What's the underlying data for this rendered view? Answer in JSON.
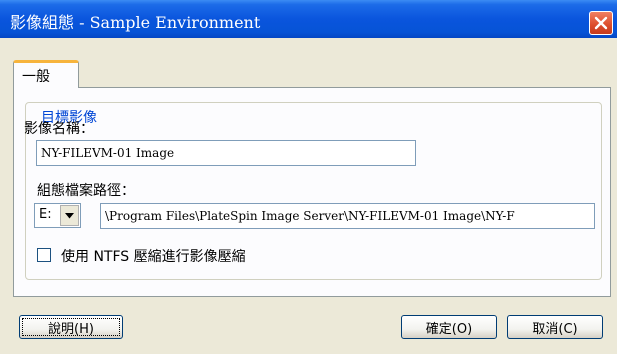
{
  "window": {
    "title": "影像組態 - Sample Environment",
    "close_icon": "close-icon"
  },
  "tabs": [
    {
      "label": "一般",
      "selected": true
    }
  ],
  "group": {
    "legend": "目標影像"
  },
  "image_name": {
    "label": "影像名稱：",
    "value": "NY-FILEVM-01 Image"
  },
  "config_path": {
    "label": "組態檔案路徑：",
    "drive_value": "E:",
    "path_value": "\\Program Files\\PlateSpin Image Server\\NY-FILEVM-01 Image\\NY-F"
  },
  "compression": {
    "label": "使用 NTFS 壓縮進行影像壓縮",
    "checked": false
  },
  "buttons": {
    "help": "說明(H)",
    "ok": "確定(O)",
    "cancel": "取消(C)"
  },
  "colors": {
    "titlebar": "#0a55dd",
    "group_legend": "#0046d5",
    "tab_highlight": "#f7b43c",
    "close_button": "#dc4c2b"
  }
}
